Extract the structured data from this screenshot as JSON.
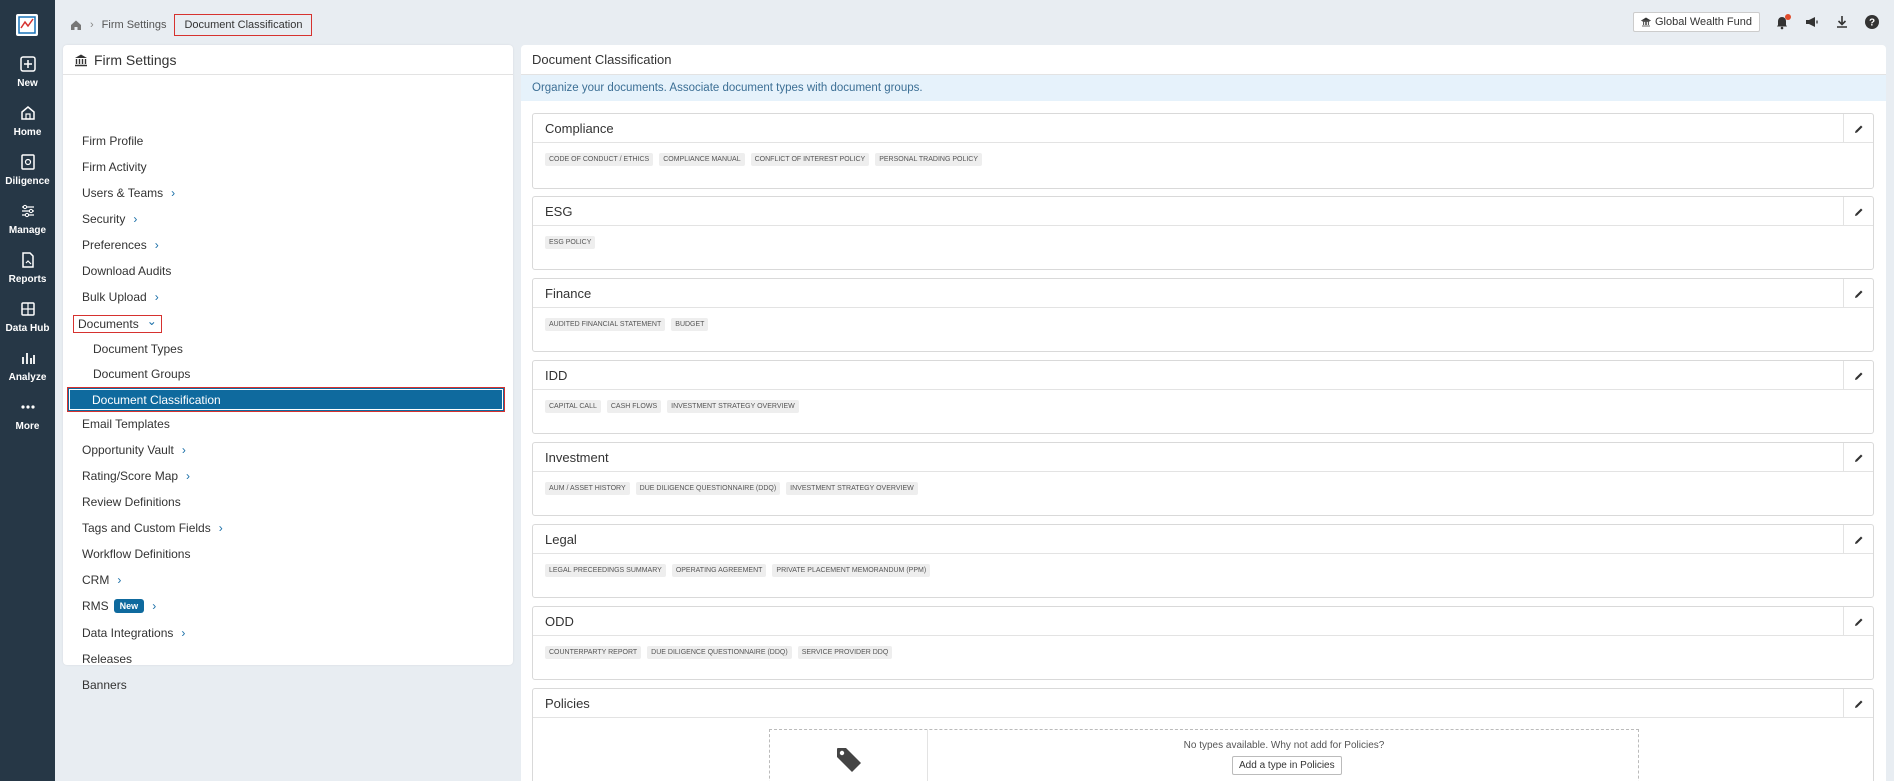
{
  "rail": {
    "items": [
      {
        "label": "New",
        "icon": "plus-square-icon"
      },
      {
        "label": "Home",
        "icon": "home-icon"
      },
      {
        "label": "Diligence",
        "icon": "diligence-icon"
      },
      {
        "label": "Manage",
        "icon": "sliders-icon"
      },
      {
        "label": "Reports",
        "icon": "report-icon"
      },
      {
        "label": "Data Hub",
        "icon": "grid-icon"
      },
      {
        "label": "Analyze",
        "icon": "bar-chart-icon"
      },
      {
        "label": "More",
        "icon": "more-dots-icon"
      }
    ]
  },
  "breadcrumb": {
    "parent": "Firm Settings",
    "current": "Document Classification"
  },
  "topbar": {
    "fund": "Global Wealth Fund"
  },
  "settings": {
    "title": "Firm Settings",
    "nav": [
      {
        "label": "Firm Profile"
      },
      {
        "label": "Firm Activity"
      },
      {
        "label": "Users & Teams",
        "chevron": "›"
      },
      {
        "label": "Security",
        "chevron": "›"
      },
      {
        "label": "Preferences",
        "chevron": "›"
      },
      {
        "label": "Download Audits"
      },
      {
        "label": "Bulk Upload",
        "chevron": "›"
      },
      {
        "label": "Documents",
        "chevron": "⌄"
      },
      {
        "label": "Document Types"
      },
      {
        "label": "Document Groups"
      },
      {
        "label": "Document Classification"
      },
      {
        "label": "Email Templates"
      },
      {
        "label": "Opportunity Vault",
        "chevron": "›"
      },
      {
        "label": "Rating/Score Map",
        "chevron": "›"
      },
      {
        "label": "Review Definitions"
      },
      {
        "label": "Tags and Custom Fields",
        "chevron": "›"
      },
      {
        "label": "Workflow Definitions"
      },
      {
        "label": "CRM",
        "chevron": "›"
      },
      {
        "label": "RMS",
        "badge": "New",
        "chevron": "›"
      },
      {
        "label": "Data Integrations",
        "chevron": "›"
      },
      {
        "label": "Releases"
      },
      {
        "label": "Banners"
      }
    ]
  },
  "main": {
    "title": "Document Classification",
    "info": "Organize your documents. Associate document types with document groups.",
    "groups": [
      {
        "name": "Compliance",
        "tags": [
          "CODE OF CONDUCT / ETHICS",
          "COMPLIANCE MANUAL",
          "CONFLICT OF INTEREST POLICY",
          "PERSONAL TRADING POLICY"
        ]
      },
      {
        "name": "ESG",
        "tags": [
          "ESG POLICY"
        ]
      },
      {
        "name": "Finance",
        "tags": [
          "AUDITED FINANCIAL STATEMENT",
          "BUDGET"
        ]
      },
      {
        "name": "IDD",
        "tags": [
          "CAPITAL CALL",
          "CASH FLOWS",
          "INVESTMENT STRATEGY OVERVIEW"
        ]
      },
      {
        "name": "Investment",
        "tags": [
          "AUM / ASSET HISTORY",
          "DUE DILIGENCE QUESTIONNAIRE (DDQ)",
          "INVESTMENT STRATEGY OVERVIEW"
        ]
      },
      {
        "name": "Legal",
        "tags": [
          "LEGAL PRECEEDINGS SUMMARY",
          "OPERATING AGREEMENT",
          "PRIVATE PLACEMENT MEMORANDUM (PPM)"
        ]
      },
      {
        "name": "ODD",
        "tags": [
          "COUNTERPARTY REPORT",
          "DUE DILIGENCE QUESTIONNAIRE (DDQ)",
          "SERVICE PROVIDER DDQ"
        ]
      },
      {
        "name": "Policies",
        "tags": []
      }
    ],
    "empty_message": "No types available. Why not add for Policies?",
    "add_button": "Add a type in Policies"
  }
}
